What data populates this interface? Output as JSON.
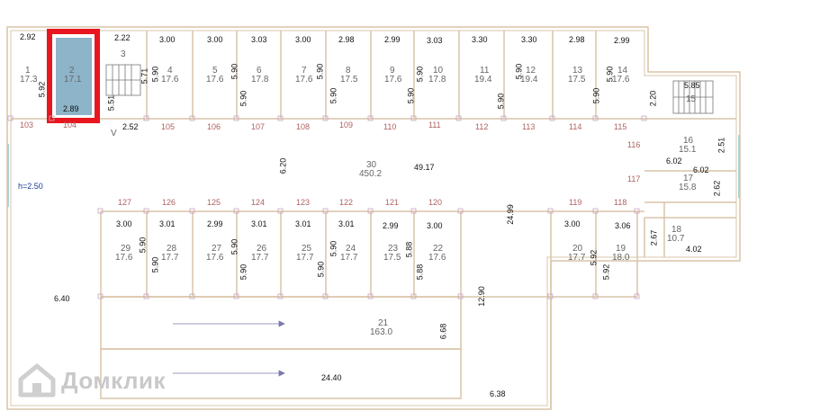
{
  "plan": {
    "height_label": "h=2.50",
    "highlight_color": "#e8161e",
    "wall_color": "#d9c4a8",
    "grid_color": "#a9d4d8",
    "rooms": [
      {
        "no": "1",
        "area": "17.3"
      },
      {
        "no": "2",
        "area": "17.1"
      },
      {
        "no": "3",
        "area": ""
      },
      {
        "no": "4",
        "area": "17.6"
      },
      {
        "no": "5",
        "area": "17.6"
      },
      {
        "no": "6",
        "area": "17.8"
      },
      {
        "no": "7",
        "area": "17.6"
      },
      {
        "no": "8",
        "area": "17.5"
      },
      {
        "no": "9",
        "area": "17.6"
      },
      {
        "no": "10",
        "area": "17.8"
      },
      {
        "no": "11",
        "area": "19.4"
      },
      {
        "no": "12",
        "area": "19.4"
      },
      {
        "no": "13",
        "area": "17.5"
      },
      {
        "no": "14",
        "area": "17.6"
      },
      {
        "no": "15",
        "area": ""
      },
      {
        "no": "16",
        "area": "15.1"
      },
      {
        "no": "17",
        "area": "15.8"
      },
      {
        "no": "18",
        "area": "10.7"
      },
      {
        "no": "19",
        "area": "18.0"
      },
      {
        "no": "20",
        "area": "17.7"
      },
      {
        "no": "21",
        "area": "163.0"
      },
      {
        "no": "22",
        "area": "17.6"
      },
      {
        "no": "23",
        "area": "17.5"
      },
      {
        "no": "24",
        "area": "17.7"
      },
      {
        "no": "25",
        "area": "17.7"
      },
      {
        "no": "26",
        "area": "17.7"
      },
      {
        "no": "27",
        "area": "17.6"
      },
      {
        "no": "28",
        "area": "17.7"
      },
      {
        "no": "29",
        "area": "17.6"
      },
      {
        "no": "30",
        "area": "450.2"
      }
    ],
    "axis_numbers": [
      "103",
      "104",
      "105",
      "106",
      "107",
      "108",
      "109",
      "110",
      "111",
      "112",
      "113",
      "114",
      "115",
      "116",
      "117",
      "118",
      "119",
      "120",
      "121",
      "122",
      "123",
      "124",
      "125",
      "126",
      "127"
    ],
    "dimensions": [
      "2.92",
      "2.22",
      "3.00",
      "3.00",
      "3.03",
      "3.00",
      "2.98",
      "2.99",
      "3.03",
      "3.30",
      "3.30",
      "2.98",
      "2.99",
      "5.92",
      "2.89",
      "5.51",
      "5.71",
      "2.52",
      "5.90",
      "5.85",
      "2.20",
      "49.17",
      "6.20",
      "2.51",
      "6.02",
      "2.62",
      "3.01",
      "2.99",
      "3.06",
      "2.67",
      "4.02",
      "5.88",
      "5.92",
      "6.40",
      "6.68",
      "12.90",
      "24.99",
      "24.40",
      "6.38"
    ],
    "door_mark": "V"
  },
  "watermark": {
    "text": "Домклик",
    "icon": "house-icon"
  }
}
